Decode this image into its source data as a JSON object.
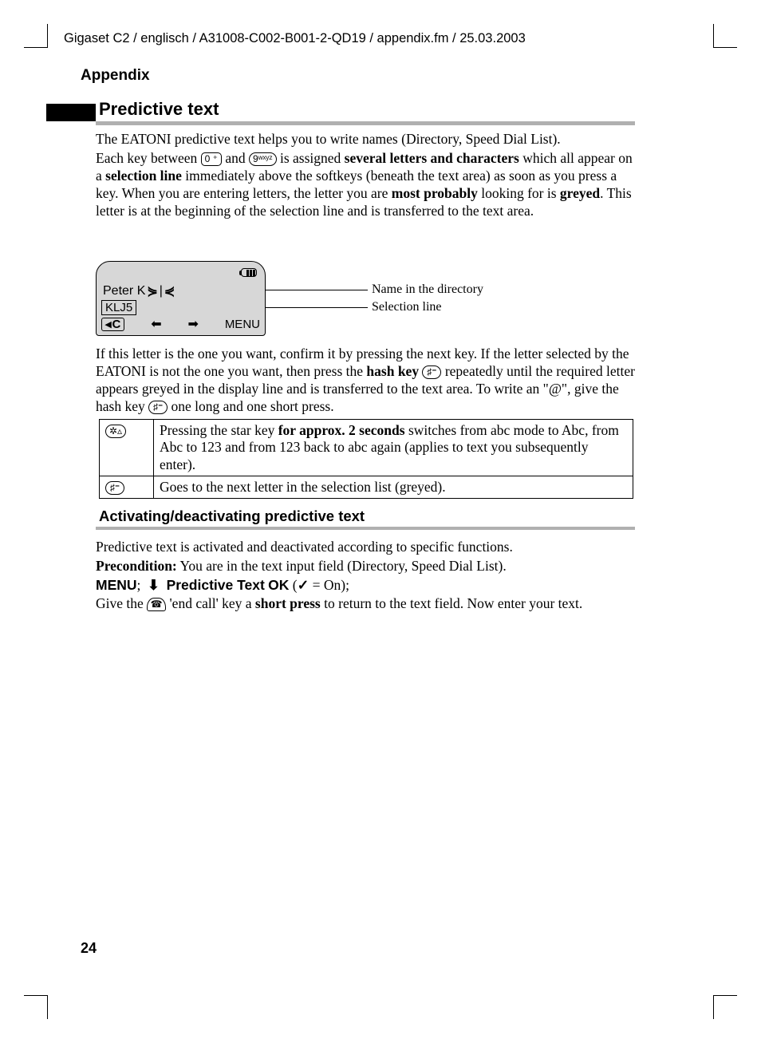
{
  "header": "Gigaset C2 / englisch / A31008-C002-B001-2-QD19 / appendix.fm / 25.03.2003",
  "section": "Appendix",
  "h2": "Predictive text",
  "para1_a": "The EATONI predictive text helps you to write names (Directory, Speed Dial List).",
  "para1_b1": "Each key between ",
  "key0": "0 ⁺",
  "para1_b2": " and ",
  "key9": "9ʷˣʸᶻ",
  "para1_b3": " is assigned ",
  "para1_bold1": "several letters and characters",
  "para1_b4": " which all appear on a ",
  "para1_bold2": "selection line",
  "para1_b5": " immediately above the softkeys (beneath the text area) as soon as you press a key. When you are entering letters, the letter you are ",
  "para1_bold3": "most probably",
  "para1_b6": " looking for is ",
  "para1_bold4": "greyed",
  "para1_b7": ". This letter is at the beginning of the selection line and is transferred to the text area.",
  "phone": {
    "name": "Peter K",
    "selection": "KLJ5",
    "cKey": "C",
    "menu": "MENU"
  },
  "callout1": "Name in the directory",
  "callout2": "Selection line",
  "para2_a": "If this letter is the one you want, confirm it by pressing the next key. If the letter selected by the EATONI is not the one you want, then press the ",
  "para2_bold1": "hash key",
  "keyHash": "♯�痩",
  "para2_b": " repeatedly until the required letter appears greyed in the display line and is transferred to the text area. To write an \"@\", give the hash key ",
  "para2_c": " one long and one short press.",
  "table": {
    "r1k": "�p˳",
    "r1a": "Pressing the star key ",
    "r1b": "for approx. 2 seconds",
    "r1c": " switches from abc mode to Abc, from Abc to 123 and from 123 back to abc again (applies to text you subsequently enter).",
    "r2a": "Goes to the next letter in the selection list (greyed)."
  },
  "h3": "Activating/deactivating predictive text",
  "act_p1": "Predictive text is activated and deactivated according to specific functions.",
  "act_pre_b": "Precondition:",
  "act_pre": " You are in the text input field (Directory, Speed Dial List).",
  "menuLabel": "MENU",
  "predLabel": "Predictive Text",
  "okLabel": "OK",
  "onText": " = On);",
  "act_last_a": "Give the ",
  "act_last_b": " 'end call' key a ",
  "act_last_bold": "short press",
  "act_last_c": " to return to the text field. Now enter your text.",
  "pageNum": "24"
}
